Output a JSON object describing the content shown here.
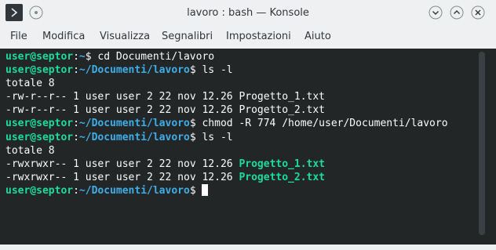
{
  "window": {
    "title": "lavoro : bash — Konsole"
  },
  "icons": {
    "app": "terminal-icon",
    "pin": "pin-icon",
    "minimize": "chevron-down-icon",
    "maximize": "chevron-up-icon",
    "close": "close-icon"
  },
  "menu": {
    "items": [
      {
        "label": "File"
      },
      {
        "label": "Modifica"
      },
      {
        "label": "Visualizza"
      },
      {
        "label": "Segnalibri"
      },
      {
        "label": "Impostazioni"
      },
      {
        "label": "Aiuto"
      }
    ]
  },
  "colors": {
    "user_prompt": "#1cdc9a",
    "path": "#3daee9",
    "executable": "#1cdc9a",
    "terminal_bg": "#232627",
    "terminal_fg": "#fcfcfc"
  },
  "terminal": {
    "prompt_user": "user@septor",
    "lines": [
      {
        "path": "~",
        "command": "cd Documenti/lavoro"
      },
      {
        "path": "~/Documenti/lavoro",
        "command": "ls -l"
      },
      {
        "text": "totale 8"
      },
      {
        "perm": "-rw-r--r--",
        "meta": " 1 user user 2 22 nov 12.26 ",
        "file": "Progetto_1.txt"
      },
      {
        "perm": "-rw-r--r--",
        "meta": " 1 user user 2 22 nov 12.26 ",
        "file": "Progetto_2.txt"
      },
      {
        "path": "~/Documenti/lavoro",
        "command": "chmod -R 774 /home/user/Documenti/lavoro"
      },
      {
        "path": "~/Documenti/lavoro",
        "command": "ls -l"
      },
      {
        "text": "totale 8"
      },
      {
        "perm": "-rwxrwxr--",
        "meta": " 1 user user 2 22 nov 12.26 ",
        "file": "Progetto_1.txt"
      },
      {
        "perm": "-rwxrwxr--",
        "meta": " 1 user user 2 22 nov 12.26 ",
        "file": "Progetto_2.txt"
      },
      {
        "path": "~/Documenti/lavoro",
        "command": ""
      }
    ]
  }
}
